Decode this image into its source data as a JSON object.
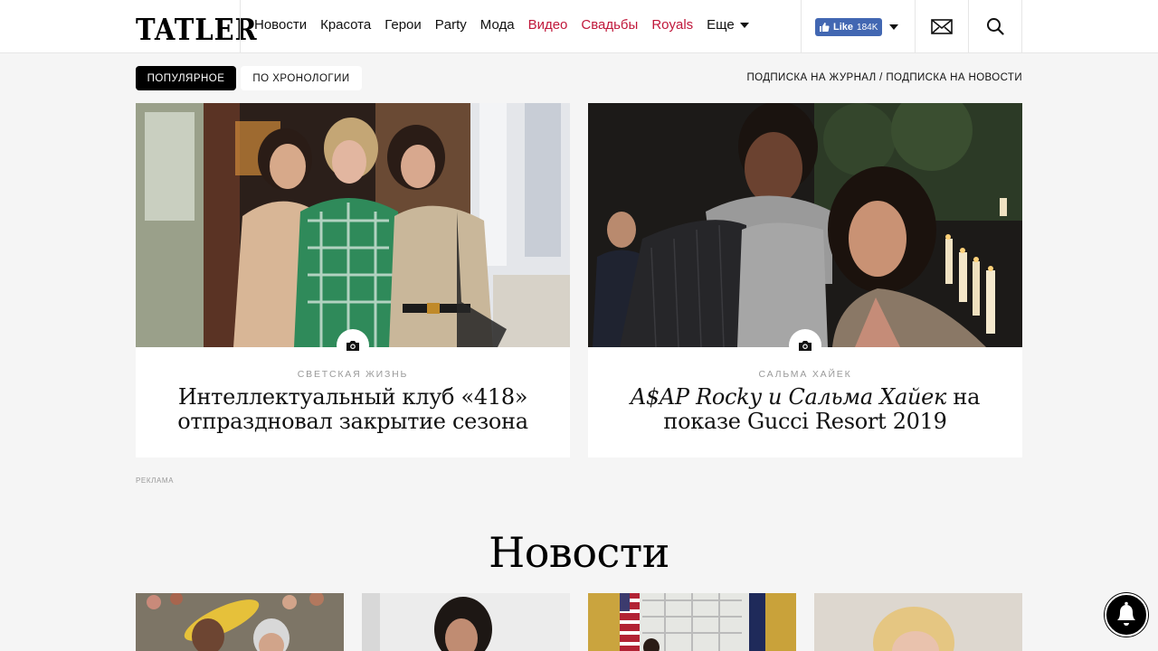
{
  "header": {
    "logo": "TATLER",
    "nav": [
      {
        "label": "Новости",
        "highlight": false
      },
      {
        "label": "Красота",
        "highlight": false
      },
      {
        "label": "Герои",
        "highlight": false
      },
      {
        "label": "Party",
        "highlight": false
      },
      {
        "label": "Мода",
        "highlight": false
      },
      {
        "label": "Видео",
        "highlight": true
      },
      {
        "label": "Свадьбы",
        "highlight": true
      },
      {
        "label": "Royals",
        "highlight": true
      }
    ],
    "more_label": "Еще",
    "fb_like": {
      "label": "Like",
      "count": "184K"
    },
    "icons": [
      "mail-icon",
      "search-icon"
    ]
  },
  "tabs": {
    "popular": "ПОПУЛЯРНОЕ",
    "chronology": "ПО ХРОНОЛОГИИ"
  },
  "subscriptions": {
    "magazine": "ПОДПИСКА НА ЖУРНАЛ",
    "separator": " / ",
    "news": "ПОДПИСКА НА НОВОСТИ"
  },
  "featured": [
    {
      "category": "СВЕТСКАЯ ЖИЗНЬ",
      "title": "Интеллектуальный клуб «418» отпраздновал закрытие сезона"
    },
    {
      "category": "САЛЬМА ХАЙЕК",
      "title_italic": "A$AP Rocky и Сальма Хайек",
      "title_rest": " на показе Gucci Resort 2019"
    }
  ],
  "ad_label": "РЕКЛАМА",
  "news_section": {
    "title": "Новости"
  },
  "colors": {
    "accent": "#c0173a",
    "fb_blue": "#4267b2",
    "background": "#f5f5f5"
  }
}
